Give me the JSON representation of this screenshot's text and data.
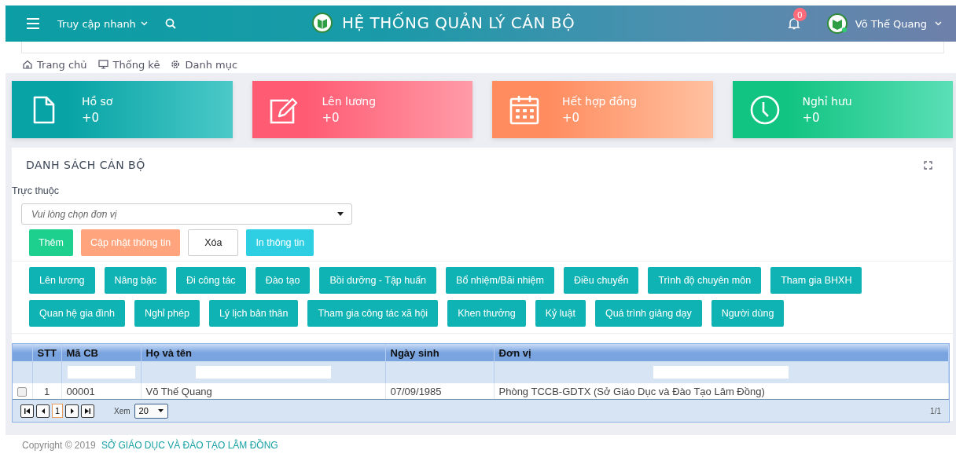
{
  "topbar": {
    "quick_access": "Truy cập nhanh",
    "title": "HỆ THỐNG QUẢN LÝ CÁN BỘ",
    "notification_count": "0",
    "user_name": "Võ Thế Quang"
  },
  "breadcrumb": [
    {
      "label": "Trang chủ",
      "kind": "home"
    },
    {
      "label": "Thống kê",
      "kind": "monitor"
    },
    {
      "label": "Danh mục",
      "kind": "gear"
    }
  ],
  "stat_cards": [
    {
      "label": "Hồ sơ",
      "value": "+0",
      "kind": "file"
    },
    {
      "label": "Lên lương",
      "value": "+0",
      "kind": "edit"
    },
    {
      "label": "Hết hợp đồng",
      "value": "+0",
      "kind": "calendar"
    },
    {
      "label": "Nghỉ hưu",
      "value": "+0",
      "kind": "clock"
    }
  ],
  "panel": {
    "title": "DANH SÁCH CÁN BỘ",
    "filter_label": "Trực thuộc",
    "unit_select": {
      "placeholder": "Vui lòng chọn đơn vị"
    },
    "actions": [
      {
        "label": "Thêm",
        "kind": "success"
      },
      {
        "label": "Cập nhật thông tin",
        "kind": "warning"
      },
      {
        "label": "Xóa",
        "kind": "plain"
      },
      {
        "label": "In thông tin",
        "kind": "info"
      }
    ],
    "module_button_rows": [
      [
        "Lên lương",
        "Nâng bậc",
        "Đi công tác",
        "Đào tạo",
        "Bồi dưỡng - Tập huấn",
        "Bổ nhiệm/Bãi nhiệm",
        "Điều chuyển",
        "Trình độ chuyên môn",
        "Tham gia BHXH"
      ],
      [
        "Quan hệ gia đình",
        "Nghỉ phép",
        "Lý lịch bản thân",
        "Tham gia công tác xã hội",
        "Khen thưởng",
        "Kỷ luật",
        "Quá trình giảng dạy",
        "Người dùng"
      ]
    ],
    "table": {
      "columns": [
        {
          "label": "STT",
          "filter": false
        },
        {
          "label": "Mã CB",
          "filter": true
        },
        {
          "label": "Họ và tên",
          "filter": true
        },
        {
          "label": "Ngày sinh",
          "filter": false
        },
        {
          "label": "Đơn vị",
          "filter": true
        }
      ],
      "rows": [
        {
          "checked": false,
          "cells": [
            "1",
            "00001",
            "Võ Thế Quang",
            "07/09/1985",
            "Phòng TCCB-GDTX (Sở Giáo Dục và Đào Tạo Lâm Đồng)"
          ]
        }
      ],
      "pager": {
        "page": "1",
        "show_label": "Xem",
        "page_size": "20",
        "page_count": "1/1"
      }
    }
  },
  "footer": {
    "copyright": "Copyright © 2019",
    "organization": "SỞ GIÁO DỤC VÀ ĐÀO TẠO LÂM ĐỒNG"
  }
}
